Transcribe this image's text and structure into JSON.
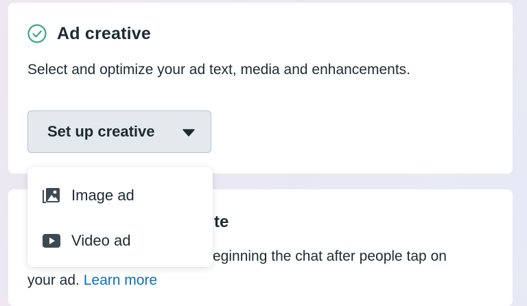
{
  "ad_creative": {
    "title": "Ad creative",
    "description": "Select and optimize your ad text, media and enhancements.",
    "setup_button_label": "Set up creative",
    "status_icon": "check-circle-icon"
  },
  "message_section": {
    "title_fragment": "te",
    "description_fragment": "eginning the chat after people tap on",
    "description_line2_prefix": "your ad. ",
    "learn_more_label": "Learn more"
  },
  "dropdown": {
    "items": [
      {
        "label": "Image ad",
        "icon": "image-icon"
      },
      {
        "label": "Video ad",
        "icon": "video-icon"
      }
    ]
  },
  "colors": {
    "check_green": "#3aa77a",
    "link_blue": "#0a6fbd",
    "button_bg": "#e4e9ee",
    "text": "#1c2b33"
  }
}
